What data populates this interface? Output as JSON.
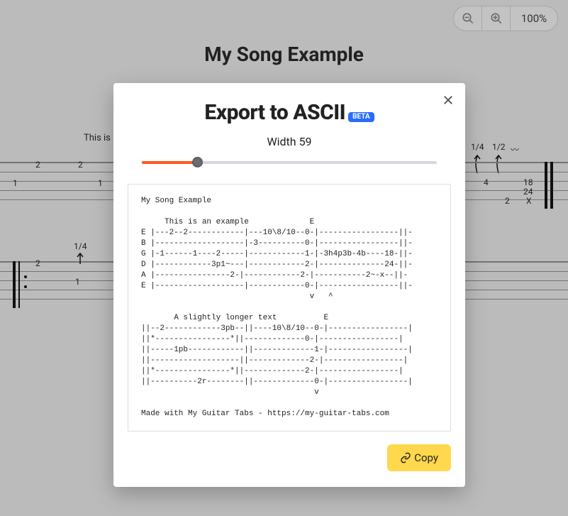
{
  "zoom": {
    "level": "100%"
  },
  "song": {
    "title": "My Song Example",
    "description_fragment": "This is",
    "fraction_1": "1/4",
    "fraction_2": "1/2",
    "fraction_3": "1/4",
    "numbers": {
      "a": "2",
      "b": "2",
      "c": "1",
      "d": "1",
      "e": "4",
      "f": "18",
      "g": "24",
      "h": "2",
      "i": "X",
      "j": "2",
      "k": "1"
    }
  },
  "modal": {
    "title": "Export to ASCII",
    "badge": "BETA",
    "width_label": "Width 59",
    "slider": {
      "value": 59,
      "min": 20,
      "max": 220
    },
    "ascii": "My Song Example\n\n     This is an example             E\nE |---2--2------------|---10\\8/10--0-|-----------------||-\nB |-------------------|-3----------0-|-----------------||-\nG |-1------1----2-----|------------1-|-3h4p3b-4b----18-||-\nD |------------3p1~---|------------2-|--------------24-||-\nA |----------------2-|------------2-|-----------2~-x--||-\nE |-------------------|------------0-|-----------------||-\n                                    v   ^\n\n       A slightly longer text          E\n||--2------------3pb--||----10\\8/10--0-|-----------------|\n||*----------------*||-------------0-|-----------------|\n||-----1pb------------||-------------1-|-----------------|\n||-------------------||-------------2-|-----------------|\n||*----------------*||-------------2-|-----------------|\n||----------2r--------||-------------0-|-----------------|\n                                     v\n\nMade with My Guitar Tabs - https://my-guitar-tabs.com",
    "copy_label": "Copy"
  }
}
